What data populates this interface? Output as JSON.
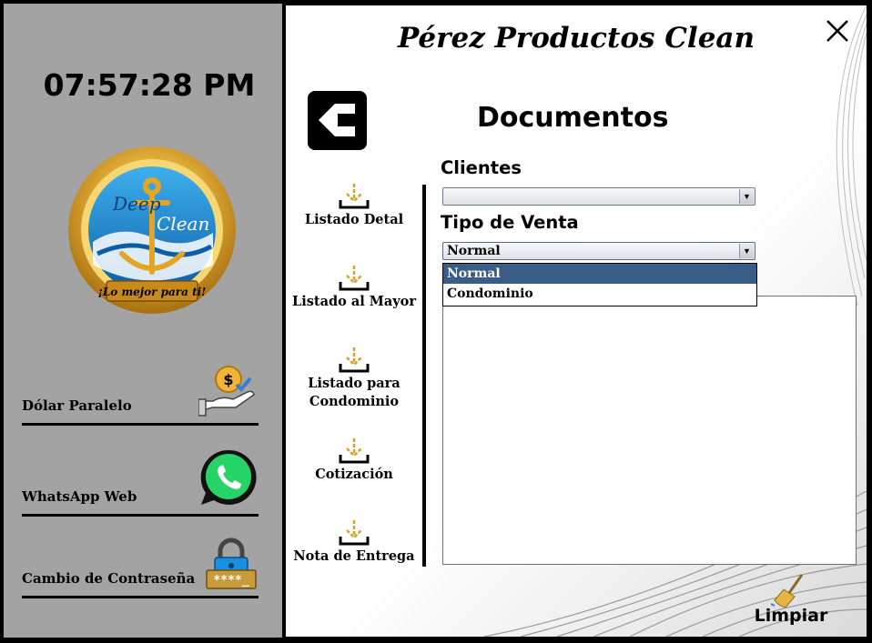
{
  "sidebar": {
    "clock": "07:57:28 PM",
    "logo": {
      "script_text_1": "Deep",
      "script_text_2": "Clean",
      "tagline": "¡Lo mejor para ti!"
    },
    "items": [
      {
        "label": "Dólar Paralelo",
        "icon": "dollar-hand-icon"
      },
      {
        "label": "WhatsApp Web",
        "icon": "whatsapp-icon"
      },
      {
        "label": "Cambio de Contraseña",
        "icon": "password-lock-icon"
      }
    ],
    "password_mask": "****_"
  },
  "header": {
    "brand": "Pérez Productos Clean",
    "page_title": "Documentos"
  },
  "doc_nav": [
    {
      "label": "Listado Detal"
    },
    {
      "label": "Listado al Mayor"
    },
    {
      "label": "Listado para Condominio"
    },
    {
      "label": "Cotización"
    },
    {
      "label": "Nota de Entrega"
    }
  ],
  "form": {
    "clientes_label": "Clientes",
    "clientes_value": "",
    "tipo_label": "Tipo de Venta",
    "tipo_value": "Normal",
    "tipo_options": [
      "Normal",
      "Condominio"
    ]
  },
  "actions": {
    "clear_label": "Limpiar"
  },
  "colors": {
    "sidebar_bg": "#a3a3a3",
    "accent_gold": "#d4a22a",
    "selected_option": "#395d86",
    "whatsapp_green": "#25d366"
  }
}
